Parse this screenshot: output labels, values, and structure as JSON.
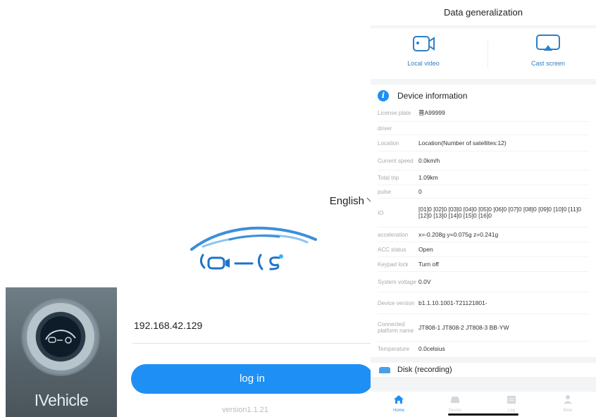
{
  "app_icon": {
    "name": "IVehicle"
  },
  "login": {
    "language": "English",
    "ip_address": "192.168.42.129",
    "login_label": "log in",
    "version": "version1.1.21"
  },
  "panel": {
    "title": "Data generalization",
    "quick_actions": [
      {
        "label": "Local video",
        "icon": "camera-icon"
      },
      {
        "label": "Cast screen",
        "icon": "cast-screen-icon"
      }
    ],
    "device_info": {
      "title": "Device information",
      "rows": [
        {
          "key": "License plate",
          "value": "晋A99999"
        },
        {
          "key": "driver",
          "value": ""
        },
        {
          "key": "Location",
          "value": "Location(Number of satellites:12)"
        },
        {
          "key": "Current speed",
          "value": "0.0km/h"
        },
        {
          "key": "Total trip",
          "value": "1.09km"
        },
        {
          "key": "pulse",
          "value": "0"
        },
        {
          "key": "IO",
          "value": "[01]0 [02]0 [03]0 [04]0 [05]0 [06]0 [07]0 [08]0 [09]0 [10]0 [11]0 [12]0 [13]0 [14]0 [15]0 [16]0"
        },
        {
          "key": "acceleration",
          "value": "x=-0.208g y=0.075g z=0.241g"
        },
        {
          "key": "ACC status",
          "value": "Open"
        },
        {
          "key": "Keypad lock",
          "value": "Turn off"
        },
        {
          "key": "System voltage",
          "value": "0.0V"
        },
        {
          "key": "Device version",
          "value": "b1.1.10.1001-T21121801-"
        },
        {
          "key": "Connected platform name",
          "value": "JT808-1 JT808-2 JT808-3 BB-YW"
        },
        {
          "key": "Temperature",
          "value": "0.0celsius"
        }
      ]
    },
    "disk": {
      "title": "Disk (recording)"
    },
    "tabs": [
      {
        "label": "Home",
        "icon": "home-icon",
        "active": true
      },
      {
        "label": "Device",
        "icon": "car-icon",
        "active": false
      },
      {
        "label": "Log",
        "icon": "log-icon",
        "active": false
      },
      {
        "label": "Mine",
        "icon": "user-icon",
        "active": false
      }
    ]
  },
  "colors": {
    "accent": "#1e90f5",
    "icon_blue": "#2f7fc8"
  }
}
